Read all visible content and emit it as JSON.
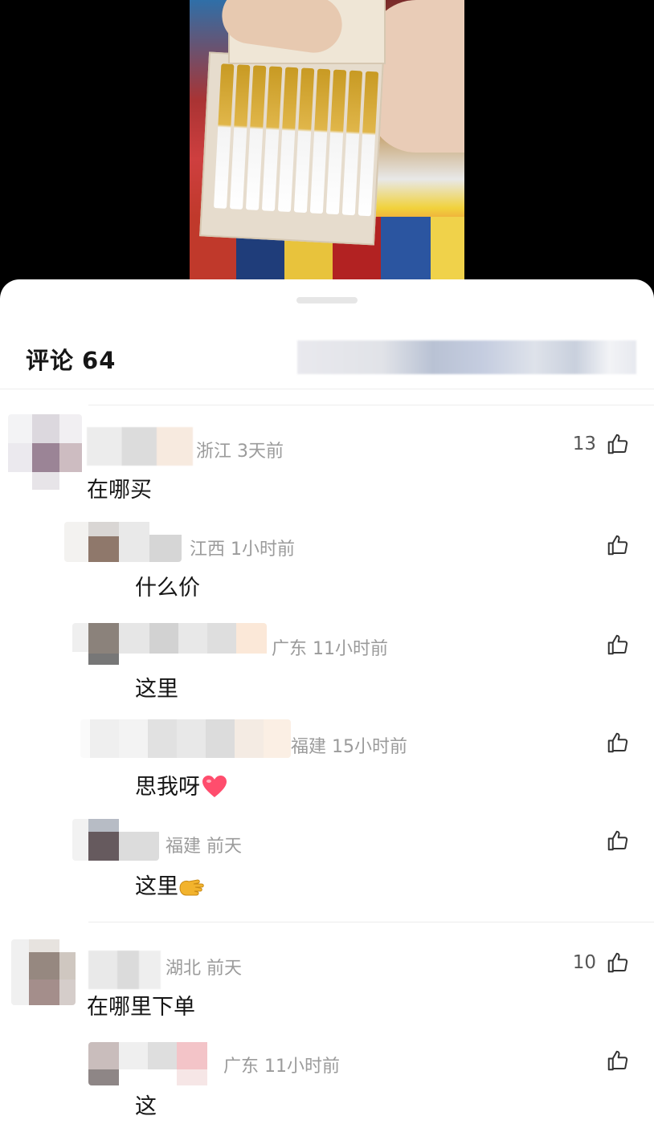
{
  "sheet": {
    "title_label": "评论",
    "count": "64"
  },
  "comments": [
    {
      "location_time": "浙江 3天前",
      "text": "在哪买",
      "likes": "13"
    },
    {
      "location_time": "江西 1小时前",
      "text": "什么价",
      "likes": ""
    },
    {
      "location_time": "广东 11小时前",
      "text": "这里",
      "likes": ""
    },
    {
      "location_time": "福建 15小时前",
      "text": "思我呀",
      "likes": "",
      "emoji": "heart-icon"
    },
    {
      "location_time": "福建 前天",
      "text": "这里",
      "likes": "",
      "emoji": "hand-icon"
    },
    {
      "location_time": "湖北 前天",
      "text": "在哪里下单",
      "likes": "10"
    },
    {
      "location_time": "广东 11小时前",
      "text": "这",
      "likes": ""
    }
  ],
  "icons": {
    "like": "thumbs-up-icon",
    "heart": "heart-icon",
    "hand": "hand-icon"
  },
  "colors": {
    "meta_text": "#9b9b9b",
    "body_text": "#161616",
    "heart": "#ff4d6d",
    "hand": "#f2b32d"
  }
}
